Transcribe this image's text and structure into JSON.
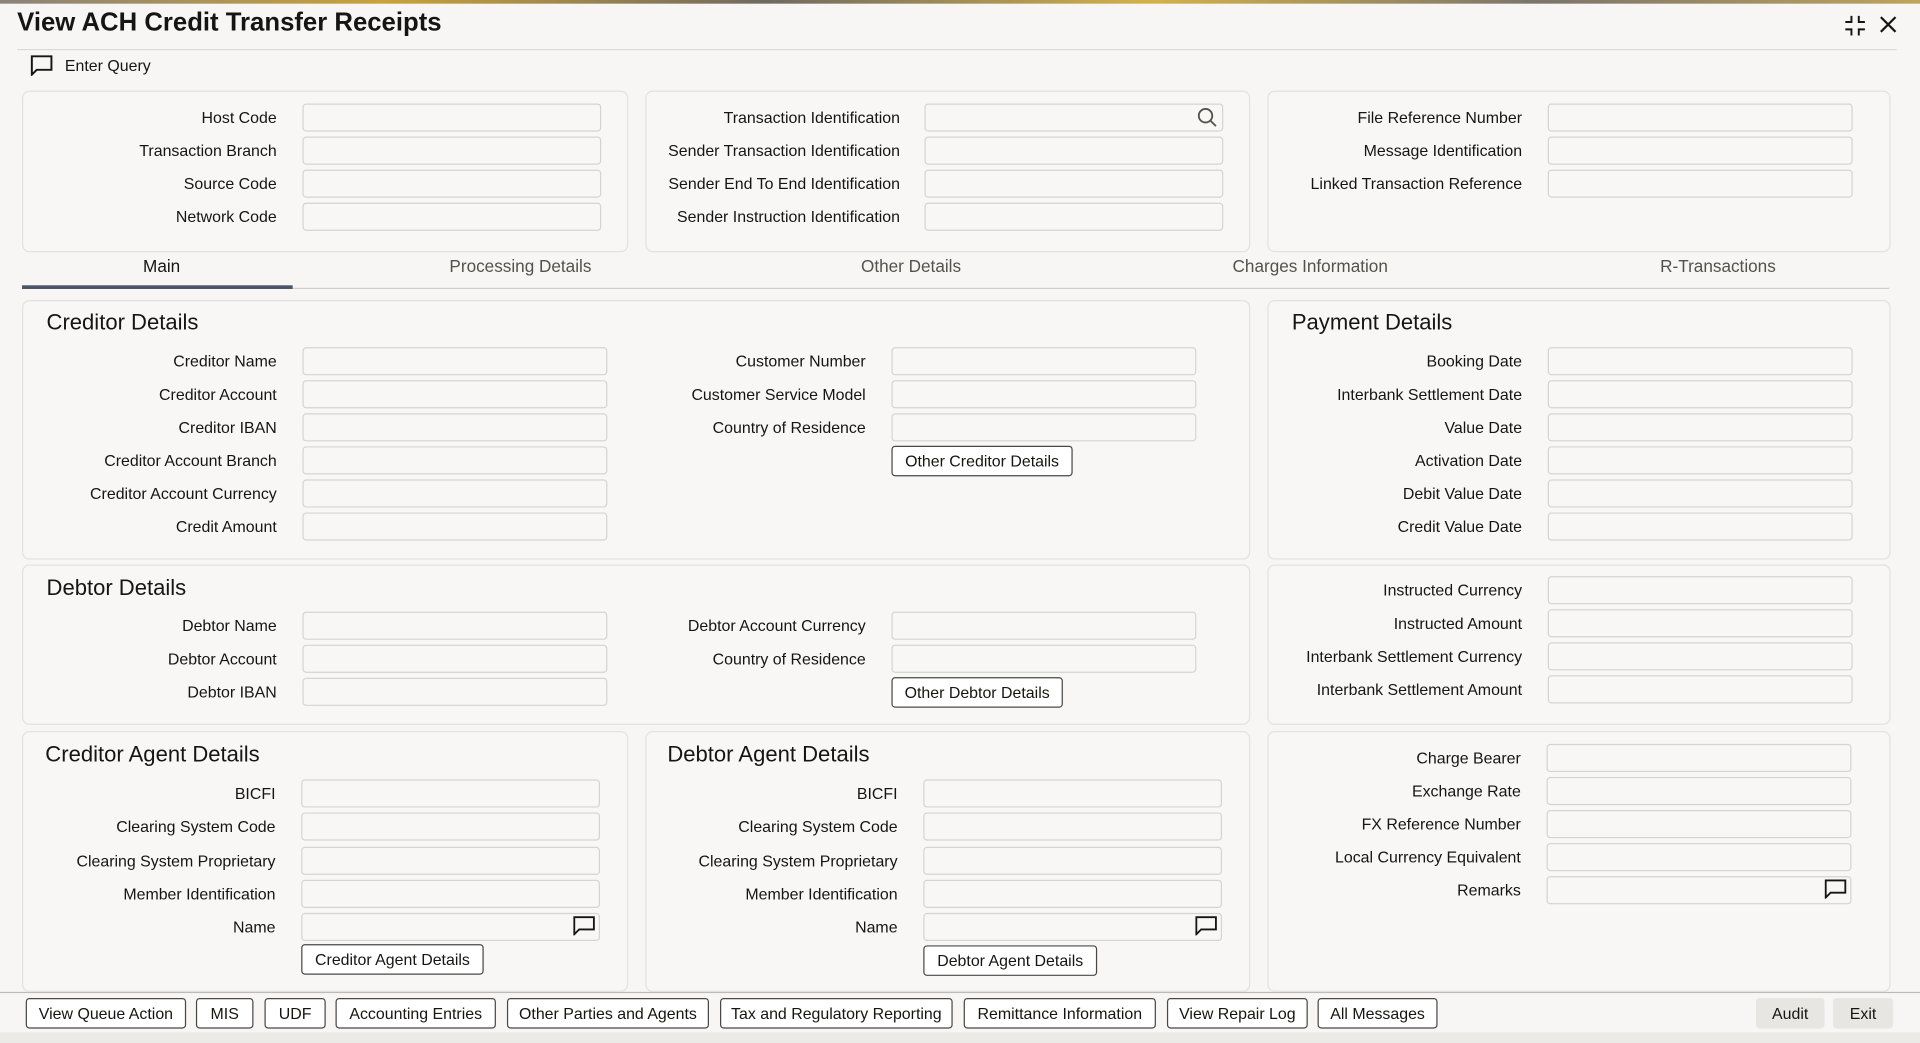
{
  "header": {
    "title": "View ACH Credit Transfer Receipts",
    "enter_query": "Enter Query"
  },
  "icons": {
    "enter_query": "chat-bubble-icon",
    "minimize": "compress-icon",
    "close": "close-icon",
    "search": "search-icon",
    "comment": "chat-bubble-icon"
  },
  "top_panels": [
    {
      "fields": [
        "Host Code",
        "Transaction Branch",
        "Source Code",
        "Network Code"
      ]
    },
    {
      "fields": [
        "Transaction Identification",
        "Sender Transaction Identification",
        "Sender End To End Identification",
        "Sender Instruction Identification"
      ]
    },
    {
      "fields": [
        "File Reference Number",
        "Message Identification",
        "Linked Transaction Reference"
      ]
    }
  ],
  "tabs": [
    "Main",
    "Processing Details",
    "Other Details",
    "Charges Information",
    "R-Transactions"
  ],
  "creditor": {
    "title": "Creditor Details",
    "col1": [
      "Creditor Name",
      "Creditor Account",
      "Creditor IBAN",
      "Creditor Account Branch",
      "Creditor Account Currency",
      "Credit Amount"
    ],
    "col2": [
      "Customer Number",
      "Customer Service Model",
      "Country of Residence"
    ],
    "button": "Other Creditor Details"
  },
  "payment": {
    "title": "Payment Details",
    "fields": [
      "Booking Date",
      "Interbank Settlement Date",
      "Value Date",
      "Activation Date",
      "Debit Value Date",
      "Credit Value Date"
    ]
  },
  "debtor": {
    "title": "Debtor Details",
    "col1": [
      "Debtor Name",
      "Debtor Account",
      "Debtor IBAN"
    ],
    "col2": [
      "Debtor Account Currency",
      "Country of Residence"
    ],
    "button": "Other Debtor Details"
  },
  "amounts": {
    "fields": [
      "Instructed Currency",
      "Instructed Amount",
      "Interbank Settlement Currency",
      "Interbank Settlement Amount"
    ]
  },
  "creditor_agent": {
    "title": "Creditor Agent Details",
    "fields": [
      "BICFI",
      "Clearing System Code",
      "Clearing System Proprietary",
      "Member Identification",
      "Name"
    ],
    "button": "Creditor Agent Details"
  },
  "debtor_agent": {
    "title": "Debtor Agent Details",
    "fields": [
      "BICFI",
      "Clearing System Code",
      "Clearing System Proprietary",
      "Member Identification",
      "Name"
    ],
    "button": "Debtor Agent Details"
  },
  "charges": {
    "fields": [
      "Charge Bearer",
      "Exchange Rate",
      "FX Reference Number",
      "Local Currency Equivalent",
      "Remarks"
    ]
  },
  "footer": {
    "buttons": [
      "View Queue Action",
      "MIS",
      "UDF",
      "Accounting Entries",
      "Other Parties and Agents",
      "Tax and Regulatory Reporting",
      "Remittance Information",
      "View Repair Log",
      "All Messages"
    ],
    "audit": "Audit",
    "exit": "Exit"
  }
}
